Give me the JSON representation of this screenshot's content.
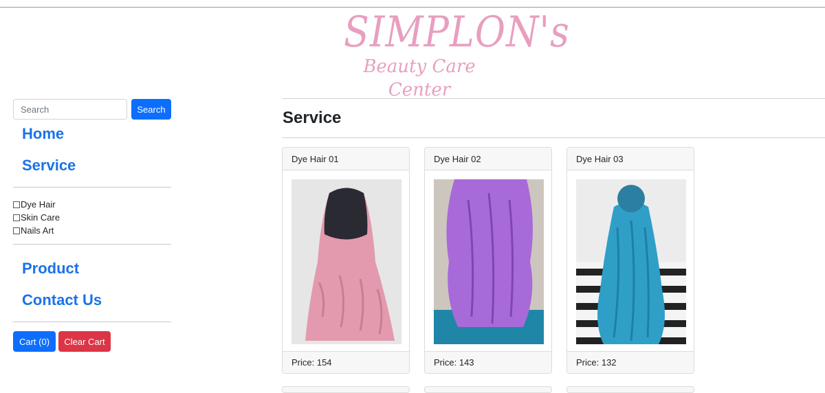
{
  "logo": {
    "line1": "SIMPLON's",
    "line2": "Beauty Care Center"
  },
  "sidebar": {
    "search": {
      "placeholder": "Search",
      "button_label": "Search"
    },
    "nav_top": [
      {
        "label": "Home"
      },
      {
        "label": "Service"
      }
    ],
    "filters": [
      {
        "label": "Dye Hair",
        "checked": false
      },
      {
        "label": "Skin Care",
        "checked": false
      },
      {
        "label": "Nails Art",
        "checked": false
      }
    ],
    "nav_bottom": [
      {
        "label": "Product"
      },
      {
        "label": "Contact Us"
      }
    ],
    "cart_label": "Cart (0)",
    "clear_cart_label": "Clear Cart"
  },
  "main": {
    "title": "Service",
    "cards": [
      {
        "title": "Dye Hair 01",
        "price": "Price: 154",
        "hair_color": "#e39aae",
        "root_color": "#2a2a33",
        "bg": "#e8e8e8"
      },
      {
        "title": "Dye Hair 02",
        "price": "Price: 143",
        "hair_color": "#a86ad8",
        "root_color": "#6a3fa0",
        "bg": "#c9c3bd"
      },
      {
        "title": "Dye Hair 03",
        "price": "Price: 132",
        "hair_color": "#2f9fc8",
        "root_color": "#2b5d6f",
        "bg": "#ececec"
      }
    ]
  },
  "colors": {
    "primary": "#0d6efd",
    "danger": "#dc3545",
    "nav_link": "#1a73e8",
    "logo_pink": "#e89fbf"
  }
}
